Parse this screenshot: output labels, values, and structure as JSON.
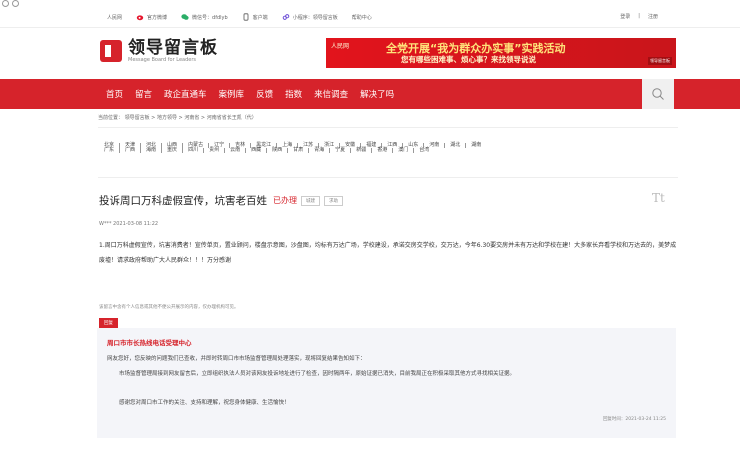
{
  "topbar": {
    "links": [
      {
        "label": "人民网",
        "icon": ""
      },
      {
        "label": "官方微博",
        "icon": "weibo-icon"
      },
      {
        "label": "微信号：dfdlyb",
        "icon": "wechat-icon"
      },
      {
        "label": "客户端",
        "icon": "phone-icon"
      },
      {
        "label": "小程序：领导留言板",
        "icon": "miniprogram-icon"
      },
      {
        "label": "帮助中心",
        "icon": ""
      }
    ],
    "login": "登录",
    "sep": "|",
    "register": "注册"
  },
  "logo": {
    "cn": "领导留言板",
    "en": "Message Board for Leaders"
  },
  "banner": {
    "tag": "人民网",
    "line1": "全党开展“我为群众办实事”实践活动",
    "line2": "您有哪些困难事、烦心事？来找领导说说",
    "corner": "领导留言板"
  },
  "nav": {
    "items": [
      "首页",
      "留言",
      "政企直通车",
      "案例库",
      "反馈",
      "指数",
      "来信调查",
      "解决了吗"
    ]
  },
  "breadcrumb": "当前位置： 领导留言板 > 地方领导 > 河南省 > 河南省省长王凯（代）",
  "regions": [
    [
      "北京",
      "天津",
      "河北",
      "山西",
      "内蒙古",
      "辽宁",
      "吉林",
      "黑龙江",
      "上海",
      "江苏",
      "浙江",
      "安徽",
      "福建",
      "江西",
      "山东",
      "河南",
      "湖北",
      "湖南"
    ],
    [
      "广东",
      "广西",
      "海南",
      "重庆",
      "四川",
      "贵州",
      "云南",
      "西藏",
      "陕西",
      "甘肃",
      "青海",
      "宁夏",
      "新疆",
      "香港",
      "澳门",
      "台湾"
    ]
  ],
  "post": {
    "title": "投诉周口万科虚假宣传，坑害老百姓",
    "status": "已办理",
    "btn1": "城建",
    "btn2": "求助",
    "fontsize_icon": "Tt",
    "meta": "W***  2021-03-08 11:22",
    "body": "1.周口万科虚假宣传，坑害消费者！宣传单页，置业顾问，楼盘示意图，沙盘图，均标有万达广场，学校建设，承诺交房交学校，交万达，今年6.30要交房并未有万达和学校在建！大多家长弃看学校和万达去的，美梦成废墟！请求政府帮助广大人民群众！！！万分感谢"
  },
  "note": "该留言中含有个人信息或其他不便公开展示的内容，仅办理机构可见。",
  "reply": {
    "tag": "回复",
    "org": "周口市市长热线电话受理中心",
    "p1": "网友您好，您反映的问题我们已查收，并即时转周口市市场监督管理局处理落实，现将回复结果告知如下：",
    "p2": "市场监督管理局接到网友留言后，立即组织执法人员对该网友投诉地址进行了检查，因时隔两年，原始证据已消失，目前我局正在积极采取其他方式寻找相关证据。",
    "p3": "感谢您对周口市工作的关注、支持和理解，祝您身体健康、生活愉快！",
    "time": "回复时间：2021-03-24 11:25"
  },
  "colors": {
    "brand": "#d6232b",
    "reply_bg": "#f4f5f9"
  }
}
